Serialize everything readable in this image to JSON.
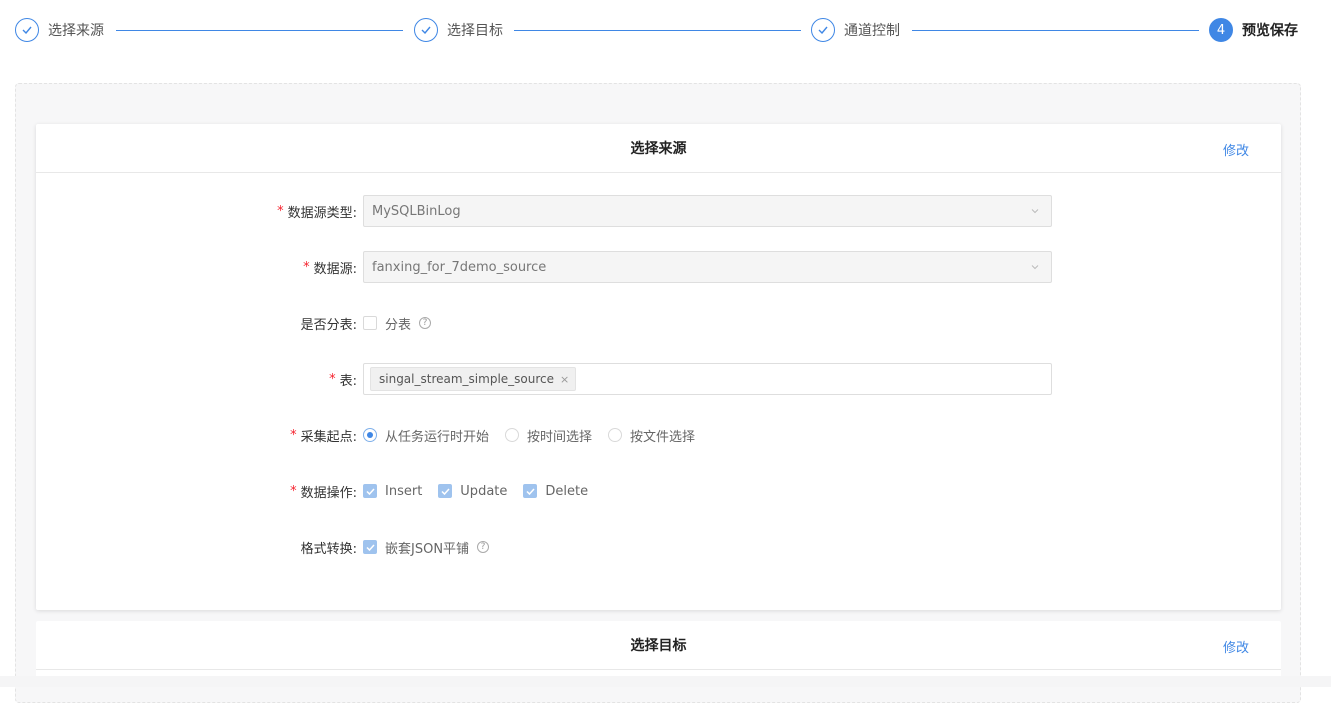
{
  "steps": [
    {
      "title": "选择来源",
      "status": "done"
    },
    {
      "title": "选择目标",
      "status": "done"
    },
    {
      "title": "通道控制",
      "status": "done"
    },
    {
      "title": "预览保存",
      "status": "active",
      "number": "4"
    }
  ],
  "colors": {
    "accent": "#3f87e5",
    "required": "#f5222d"
  },
  "source_card": {
    "title": "选择来源",
    "edit_label": "修改",
    "fields": {
      "source_type": {
        "label": "数据源类型:",
        "value": "MySQLBinLog"
      },
      "source": {
        "label": "数据源:",
        "value": "fanxing_for_7demo_source"
      },
      "sharding": {
        "label": "是否分表:",
        "option": "分表",
        "checked": false
      },
      "table": {
        "label": "表:",
        "tag": "singal_stream_simple_source",
        "remove": "×"
      },
      "start_point": {
        "label": "采集起点:",
        "options": [
          "从任务运行时开始",
          "按时间选择",
          "按文件选择"
        ],
        "selected": "从任务运行时开始"
      },
      "operations": {
        "label": "数据操作:",
        "options": [
          "Insert",
          "Update",
          "Delete"
        ],
        "checked": [
          true,
          true,
          true
        ]
      },
      "format": {
        "label": "格式转换:",
        "option": "嵌套JSON平铺",
        "checked": true
      }
    },
    "help_glyph": "?"
  },
  "target_card": {
    "title": "选择目标",
    "edit_label": "修改"
  }
}
